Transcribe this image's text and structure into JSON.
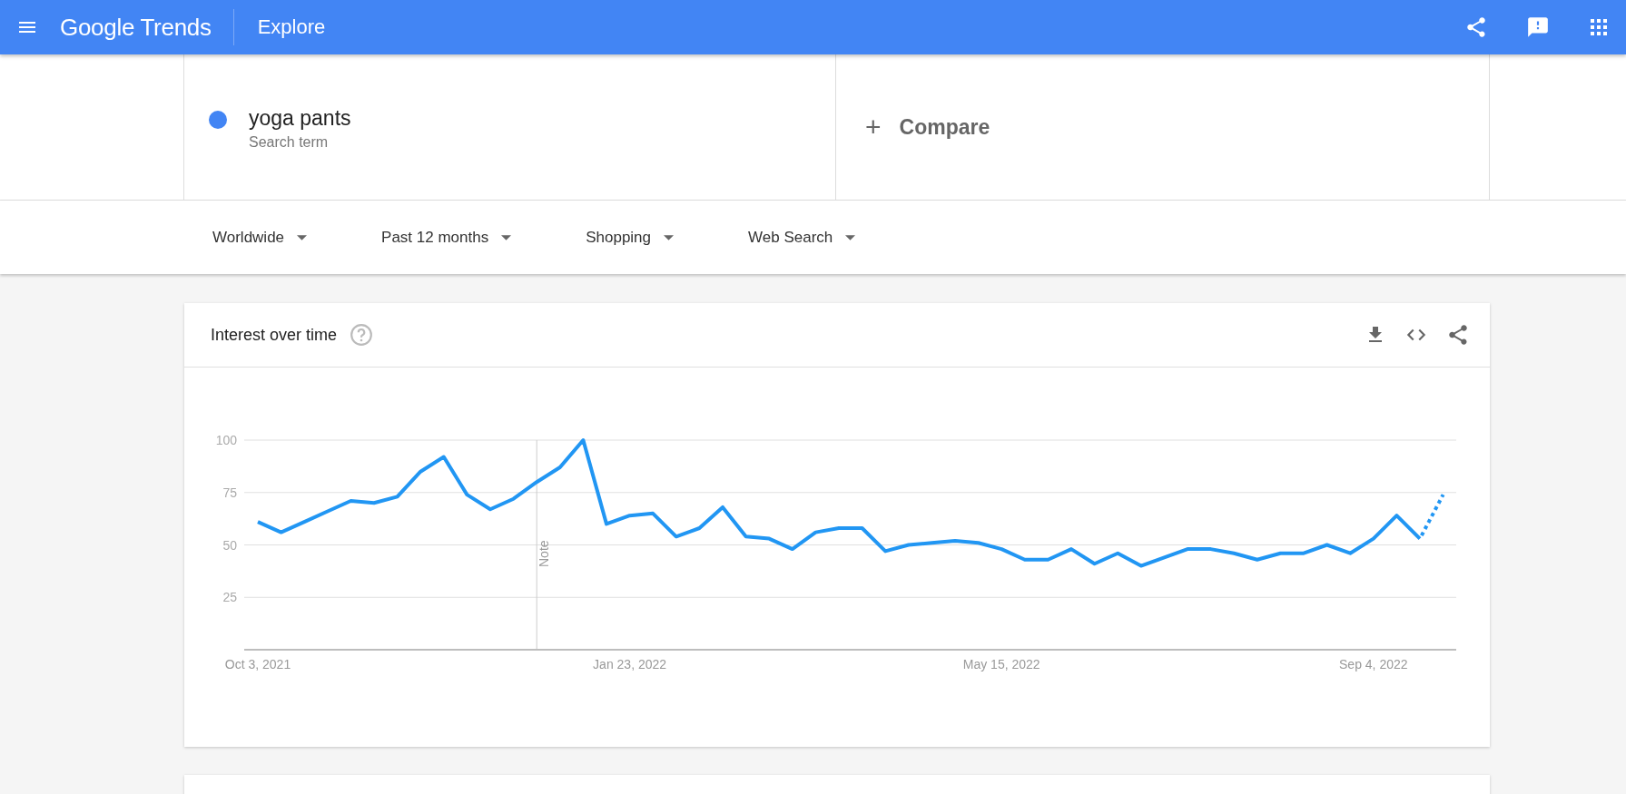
{
  "header": {
    "logo": "Google Trends",
    "title": "Explore"
  },
  "search_terms": [
    {
      "term": "yoga pants",
      "type_label": "Search term",
      "color": "#4285f4"
    }
  ],
  "compare": {
    "icon": "+",
    "label": "Compare"
  },
  "filters": [
    {
      "label": "Worldwide"
    },
    {
      "label": "Past 12 months"
    },
    {
      "label": "Shopping"
    },
    {
      "label": "Web Search"
    }
  ],
  "interest_over_time": {
    "title": "Interest over time",
    "chart_data": {
      "type": "line",
      "grid": true,
      "categories": [
        "Oct 3, 2021",
        null,
        null,
        null,
        null,
        null,
        null,
        null,
        null,
        null,
        null,
        null,
        null,
        null,
        null,
        null,
        "Jan 23, 2022",
        null,
        null,
        null,
        null,
        null,
        null,
        null,
        null,
        null,
        null,
        null,
        null,
        null,
        null,
        null,
        "May 15, 2022",
        null,
        null,
        null,
        null,
        null,
        null,
        null,
        null,
        null,
        null,
        null,
        null,
        null,
        null,
        null,
        "Sep 4, 2022",
        null,
        null,
        null
      ],
      "ylim": [
        0,
        100
      ],
      "yticks": [
        25,
        50,
        75,
        100
      ],
      "series": [
        {
          "color": "#2196f3",
          "line_style": "dotted_last_segment",
          "values": [
            61,
            56,
            61,
            66,
            71,
            70,
            73,
            85,
            92,
            74,
            67,
            72,
            80,
            87,
            100,
            60,
            64,
            65,
            54,
            58,
            68,
            54,
            53,
            48,
            56,
            58,
            58,
            47,
            50,
            51,
            52,
            51,
            48,
            43,
            43,
            48,
            41,
            46,
            40,
            44,
            48,
            48,
            46,
            43,
            46,
            46,
            50,
            46,
            53,
            64,
            53,
            74
          ]
        }
      ],
      "annotations": [
        "Note"
      ]
    }
  }
}
